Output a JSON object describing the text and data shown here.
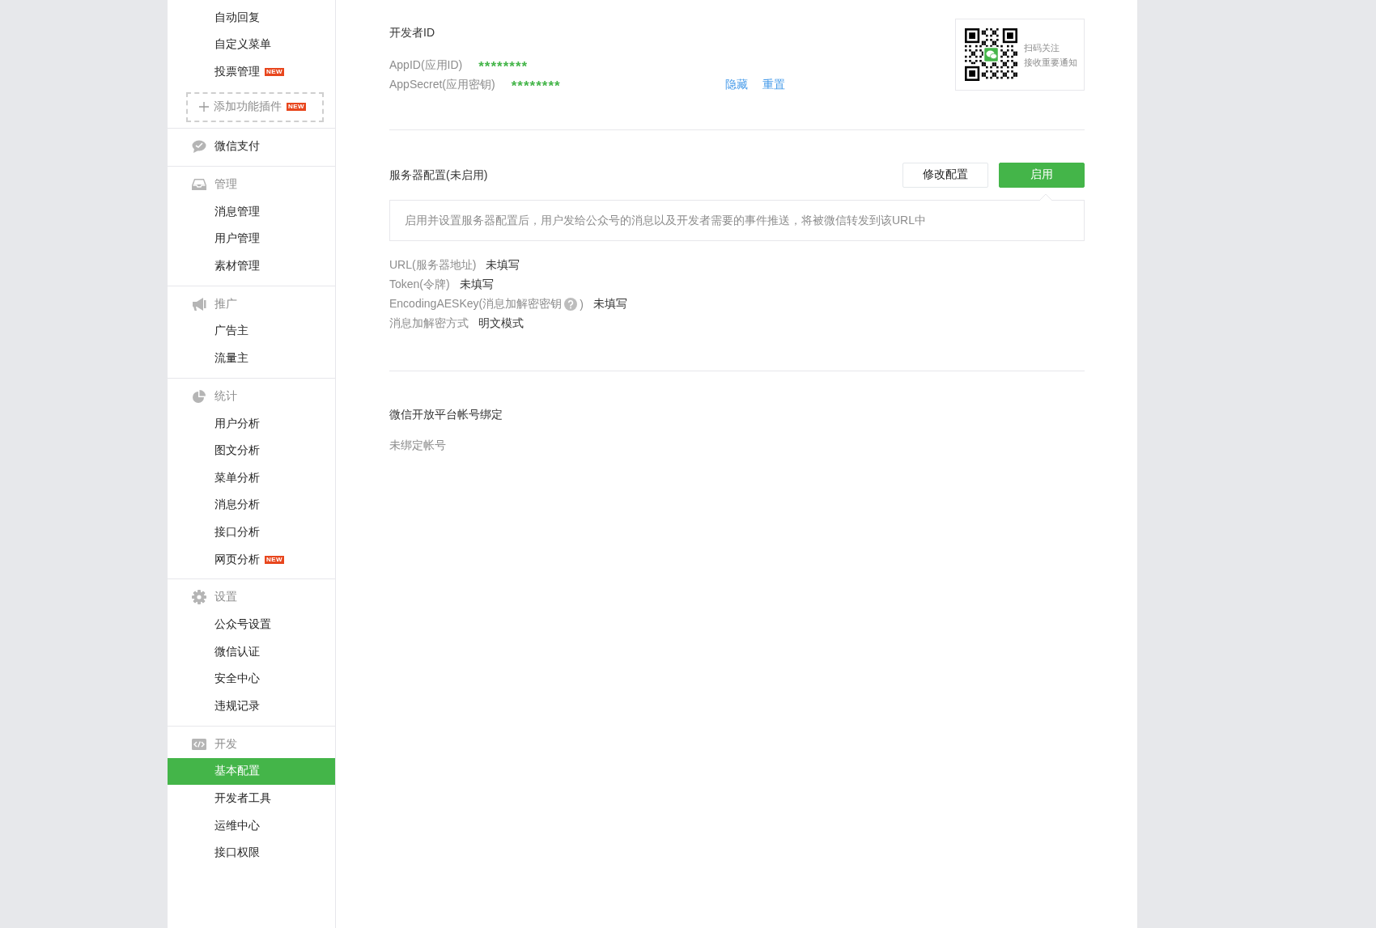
{
  "sidebar": {
    "sections": [
      {
        "kind": "group",
        "items": [
          {
            "label": "自动回复",
            "selected": false
          },
          {
            "label": "自定义菜单",
            "selected": false
          },
          {
            "label": "投票管理",
            "badge": "NEW",
            "selected": false
          }
        ],
        "add_button": {
          "label": "添加功能插件",
          "badge": "NEW"
        }
      },
      {
        "kind": "link",
        "title": "微信支付"
      },
      {
        "kind": "group",
        "title": "管理",
        "items": [
          {
            "label": "消息管理",
            "selected": false
          },
          {
            "label": "用户管理",
            "selected": false
          },
          {
            "label": "素材管理",
            "selected": false
          }
        ]
      },
      {
        "kind": "group",
        "title": "推广",
        "items": [
          {
            "label": "广告主",
            "selected": false
          },
          {
            "label": "流量主",
            "selected": false
          }
        ]
      },
      {
        "kind": "group",
        "title": "统计",
        "items": [
          {
            "label": "用户分析",
            "selected": false
          },
          {
            "label": "图文分析",
            "selected": false
          },
          {
            "label": "菜单分析",
            "selected": false
          },
          {
            "label": "消息分析",
            "selected": false
          },
          {
            "label": "接口分析",
            "selected": false
          },
          {
            "label": "网页分析",
            "badge": "NEW",
            "selected": false
          }
        ]
      },
      {
        "kind": "group",
        "title": "设置",
        "items": [
          {
            "label": "公众号设置",
            "selected": false
          },
          {
            "label": "微信认证",
            "selected": false
          },
          {
            "label": "安全中心",
            "selected": false
          },
          {
            "label": "违规记录",
            "selected": false
          }
        ]
      },
      {
        "kind": "group",
        "title": "开发",
        "items": [
          {
            "label": "基本配置",
            "selected": true
          },
          {
            "label": "开发者工具",
            "selected": false
          },
          {
            "label": "运维中心",
            "selected": false
          },
          {
            "label": "接口权限",
            "selected": false
          }
        ]
      }
    ]
  },
  "developer_id": {
    "title": "开发者ID",
    "fields": [
      {
        "label": "AppID(应用ID)",
        "value": "********"
      },
      {
        "label": "AppSecret(应用密钥)",
        "value": "********",
        "links": [
          "隐藏",
          "重置"
        ]
      }
    ],
    "qr_card": {
      "lines": [
        "扫码关注",
        "接收重要通知"
      ]
    }
  },
  "server_config": {
    "title": "服务器配置(未启用)",
    "buttons": [
      {
        "label": "修改配置",
        "kind": "default"
      },
      {
        "label": "启用",
        "kind": "primary"
      }
    ],
    "notice": "启用并设置服务器配置后，用户发给公众号的消息以及开发者需要的事件推送，将被微信转发到该URL中",
    "fields": [
      {
        "label": "URL(服务器地址)",
        "help": false,
        "value": "未填写"
      },
      {
        "label": "Token(令牌)",
        "help": false,
        "value": "未填写"
      },
      {
        "label": "EncodingAESKey(消息加解密密钥",
        "help": true,
        "label_after": ")",
        "value": "未填写"
      },
      {
        "label": "消息加解密方式",
        "help": false,
        "value": "明文模式"
      }
    ]
  },
  "open_platform": {
    "title": "微信开放平台帐号绑定",
    "status": "未绑定帐号"
  }
}
